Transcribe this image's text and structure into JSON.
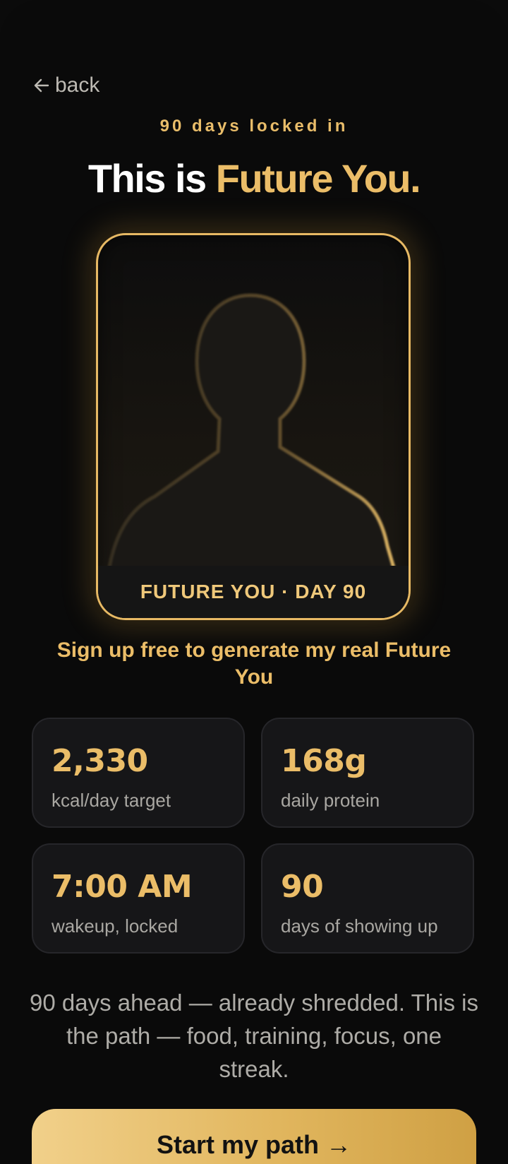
{
  "nav": {
    "back_label": "back"
  },
  "header": {
    "eyebrow": "90 days locked in",
    "title_prefix": "This is ",
    "title_accent": "Future You."
  },
  "preview_card": {
    "label": "FUTURE YOU · DAY 90"
  },
  "signup_link": "Sign up free to generate my real Future You",
  "stats": [
    {
      "value": "2,330",
      "caption": "kcal/day target"
    },
    {
      "value": "168g",
      "caption": "daily protein"
    },
    {
      "value": "7:00 AM",
      "caption": "wakeup, locked"
    },
    {
      "value": "90",
      "caption": "days of showing up"
    }
  ],
  "description": "90 days ahead — already shredded. This is the path — food, training, focus, one streak.",
  "cta": {
    "label": "Start my path →"
  },
  "colors": {
    "background": "#0a0a0a",
    "accent_gold": "#ebbd68",
    "card_surface": "#161618",
    "cta_gradient_start": "#f1d08a",
    "cta_gradient_end": "#cfa044"
  }
}
